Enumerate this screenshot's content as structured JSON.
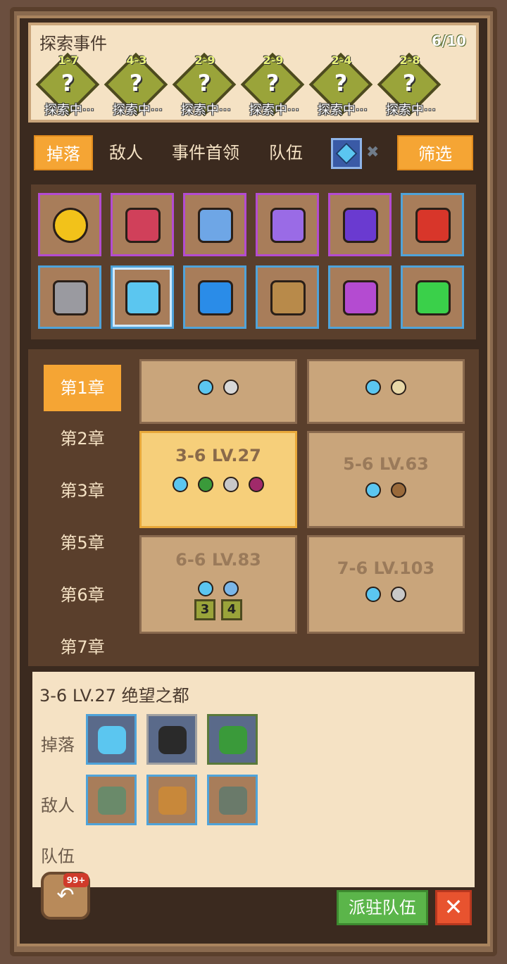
{
  "explore": {
    "title": "探索事件",
    "count": "6/10",
    "events": [
      {
        "level": "1-7",
        "status": "探索中···"
      },
      {
        "level": "4-3",
        "status": "探索中···"
      },
      {
        "level": "2-9",
        "status": "探索中···"
      },
      {
        "level": "2-9",
        "status": "探索中···"
      },
      {
        "level": "2-4",
        "status": "探索中···"
      },
      {
        "level": "2-8",
        "status": "探索中···"
      }
    ]
  },
  "tabs": [
    "掉落",
    "敌人",
    "事件首领",
    "队伍"
  ],
  "active_tab": "掉落",
  "filter_label": "筛选",
  "items": [
    {
      "icon": "gold-coin-icon",
      "color": "#f2c21a",
      "frame": "purple"
    },
    {
      "icon": "red-crystal-icon",
      "color": "#d0405a",
      "frame": "purple"
    },
    {
      "icon": "blue-crystal-icon",
      "color": "#6ea6e6",
      "frame": "purple"
    },
    {
      "icon": "purple-crystal-icon",
      "color": "#9a6be6",
      "frame": "purple"
    },
    {
      "icon": "purple-gem-icon",
      "color": "#6a3ad0",
      "frame": "purple"
    },
    {
      "icon": "red-ore-icon",
      "color": "#d8362a",
      "frame": "blue"
    },
    {
      "icon": "stone-icon",
      "color": "#9a9aa0",
      "frame": "blue"
    },
    {
      "icon": "blue-feather-gem-icon",
      "color": "#5bc6f0",
      "frame": "blue",
      "selected": true
    },
    {
      "icon": "blue-ore-icon",
      "color": "#2a8ce8",
      "frame": "blue"
    },
    {
      "icon": "wood-ingot-icon",
      "color": "#b88a4a",
      "frame": "blue"
    },
    {
      "icon": "purple-leaf-gem-icon",
      "color": "#b44bd1",
      "frame": "blue"
    },
    {
      "icon": "green-ore-icon",
      "color": "#3ad04a",
      "frame": "blue"
    }
  ],
  "chapters": [
    "第1章",
    "第2章",
    "第3章",
    "第5章",
    "第6章",
    "第7章"
  ],
  "active_chapter": "第1章",
  "stages": [
    {
      "name": "",
      "drops": [
        "#5bc6f0",
        "#d8d8d8"
      ]
    },
    {
      "name": "",
      "drops": [
        "#5bc6f0",
        "#e8d8a8"
      ]
    },
    {
      "name": "3-6 LV.27",
      "drops": [
        "#5bc6f0",
        "#3a9a3a",
        "#c8c8c8",
        "#a02a6a"
      ],
      "active": true
    },
    {
      "name": "5-6 LV.63",
      "drops": [
        "#5bc6f0",
        "#9a6a3a"
      ]
    },
    {
      "name": "6-6 LV.83",
      "drops": [
        "#5bc6f0",
        "#7ab6e8"
      ],
      "badges": [
        "3",
        "4"
      ]
    },
    {
      "name": "7-6 LV.103",
      "drops": [
        "#5bc6f0",
        "#c8c8c8"
      ]
    }
  ],
  "detail": {
    "title": "3-6 LV.27 绝望之都",
    "drop_label": "掉落",
    "enemy_label": "敌人",
    "team_label": "队伍",
    "drops": [
      {
        "icon": "blue-feather-gem-icon",
        "color": "#5bc6f0",
        "frame": "#4fa3d9"
      },
      {
        "icon": "black-pudding-icon",
        "color": "#2a2a2a",
        "frame": "#a0a0a0"
      },
      {
        "icon": "green-leaf-icon",
        "color": "#3a9a3a",
        "frame": "#5a7a3a"
      }
    ],
    "enemies": [
      {
        "icon": "stone-golem-icon",
        "color": "#6a8a6a"
      },
      {
        "icon": "monkey-icon",
        "color": "#c8883a"
      },
      {
        "icon": "rock-spirit-icon",
        "color": "#6a7a6a"
      }
    ]
  },
  "buttons": {
    "back_badge": "99+",
    "dispatch": "派驻队伍",
    "close": "✕"
  }
}
